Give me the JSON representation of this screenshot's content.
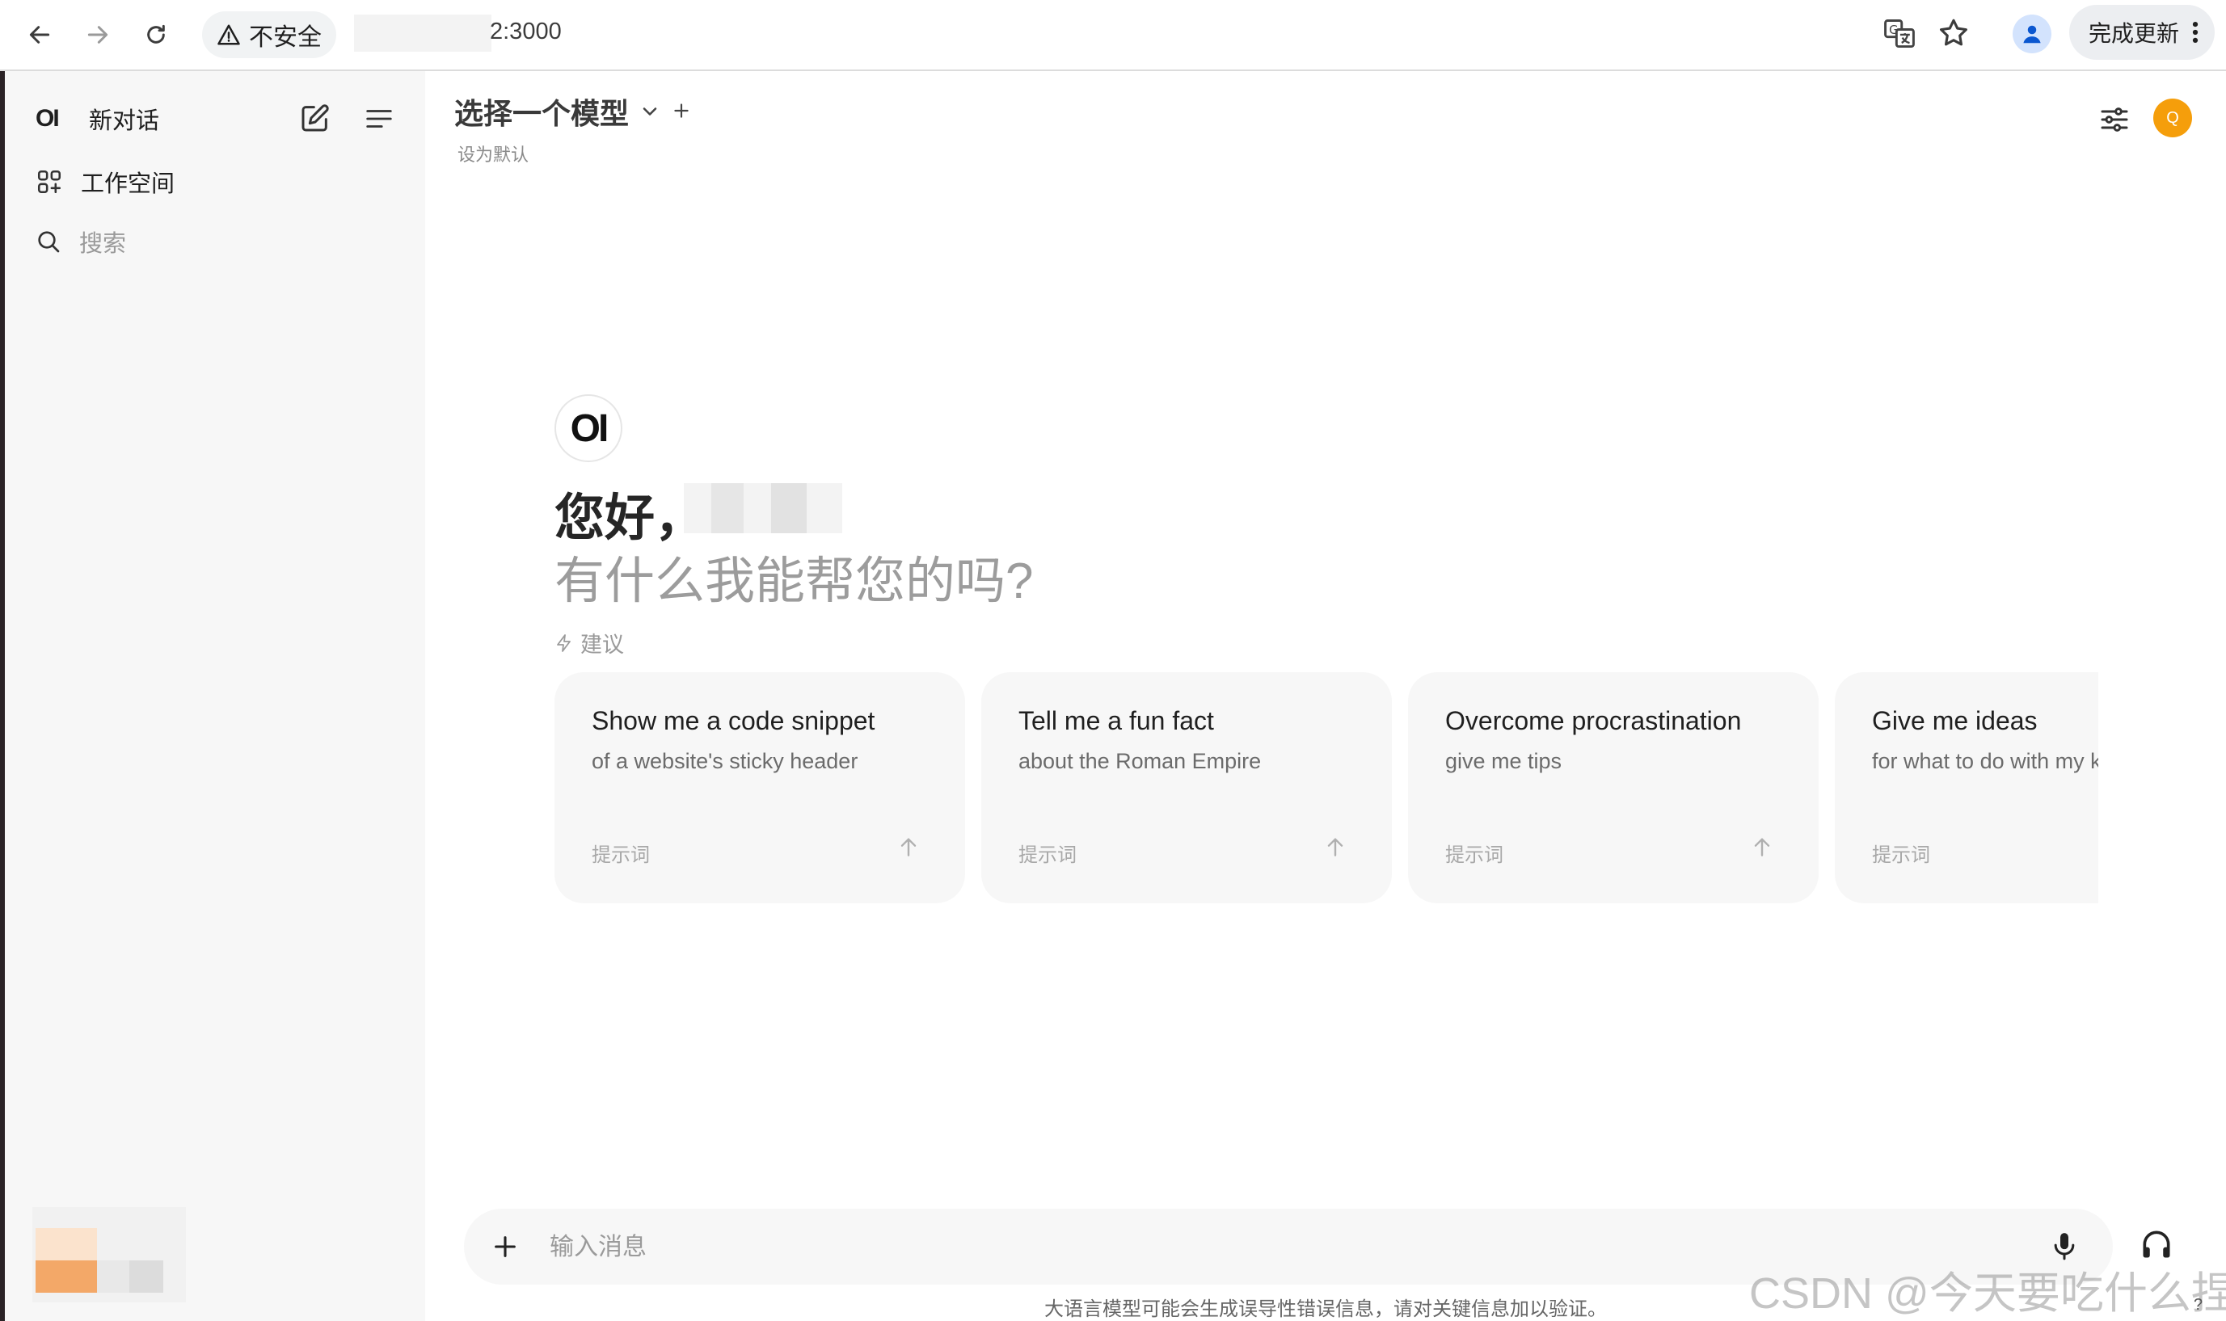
{
  "browser": {
    "security_label": "不安全",
    "url_suffix": "2:3000",
    "update_button": "完成更新"
  },
  "sidebar": {
    "brand_logo": "OI",
    "new_chat": "新对话",
    "workspace": "工作空间",
    "search": "搜索"
  },
  "header": {
    "model_selector": "选择一个模型",
    "set_default": "设为默认",
    "avatar_letter": "Q",
    "accent": "#f59e0b"
  },
  "main": {
    "logo": "OI",
    "greeting": "您好，",
    "subtitle": "有什么我能帮您的吗?",
    "suggestions_label": "建议",
    "cards": [
      {
        "title": "Show me a code snippet",
        "subtitle": "of a website's sticky header",
        "footer": "提示词"
      },
      {
        "title": "Tell me a fun fact",
        "subtitle": "about the Roman Empire",
        "footer": "提示词"
      },
      {
        "title": "Overcome procrastination",
        "subtitle": "give me tips",
        "footer": "提示词"
      },
      {
        "title": "Give me ideas",
        "subtitle": "for what to do with my k",
        "footer": "提示词"
      }
    ]
  },
  "composer": {
    "placeholder": "输入消息"
  },
  "footer": {
    "disclaimer": "大语言模型可能会生成误导性错误信息，请对关键信息加以验证。",
    "help": "?"
  },
  "watermark": "CSDN @今天要吃什么捏"
}
